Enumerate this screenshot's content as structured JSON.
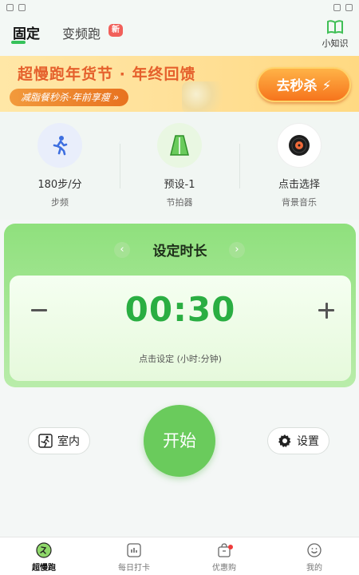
{
  "header": {
    "tab_fixed": "固定",
    "tab_variable": "变频跑",
    "new_badge": "新",
    "knowledge_label": "小知识"
  },
  "banner": {
    "title": "超慢跑年货节 · 年终回馈",
    "subtitle": "减脂餐秒杀·年前享瘦 »",
    "button": "去秒杀 ⚡"
  },
  "quick_items": [
    {
      "value": "180步/分",
      "label": "步频"
    },
    {
      "value": "预设-1",
      "label": "节拍器"
    },
    {
      "value": "点击选择",
      "label": "背景音乐"
    }
  ],
  "timer": {
    "title": "设定时长",
    "time": "00:30",
    "hint": "点击设定 (小时:分钟)"
  },
  "actions": {
    "indoor": "室内",
    "start": "开始",
    "settings": "设置"
  },
  "nav": [
    {
      "label": "超慢跑"
    },
    {
      "label": "每日打卡"
    },
    {
      "label": "优惠购"
    },
    {
      "label": "我的"
    }
  ],
  "colors": {
    "accent": "#36c25a",
    "timer_text": "#2aae42",
    "banner_title": "#e5602c",
    "start_button": "#6acb5c"
  }
}
